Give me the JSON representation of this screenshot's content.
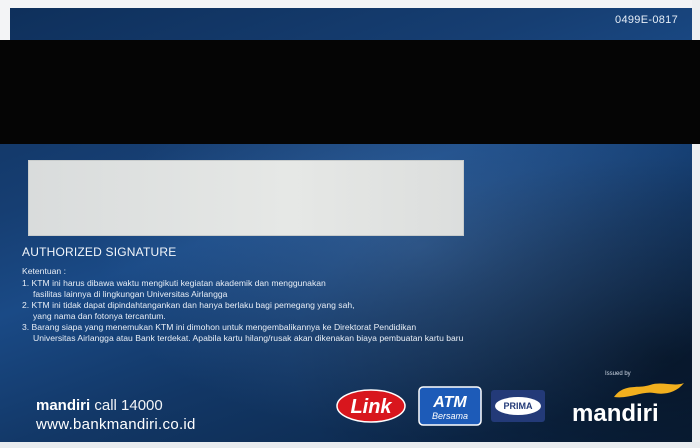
{
  "card": {
    "code": "0499E-0817",
    "signature_label": "AUTHORIZED SIGNATURE",
    "terms": {
      "heading": "Ketentuan :",
      "lines": [
        "1. KTM ini harus dibawa waktu mengikuti kegiatan akademik dan menggunakan",
        "fasilitas lainnya di lingkungan Universitas Airlangga",
        "2. KTM ini tidak dapat dipindahtangankan dan hanya berlaku bagi pemegang yang sah,",
        "yang nama dan fotonya tercantum.",
        "3. Barang siapa yang menemukan KTM ini dimohon untuk mengembalikannya ke Direktorat Pendidikan",
        "Universitas Airlangga atau Bank terdekat. Apabila kartu hilang/rusak akan dikenakan biaya pembuatan kartu baru"
      ]
    },
    "bank": {
      "name": "mandiri",
      "call": "call 14000",
      "url": "www.bankmandiri.co.id"
    },
    "logos": {
      "link": "Link",
      "atm_top": "ATM",
      "atm_bottom": "Bersama",
      "prima": "PRIMA",
      "issued_by": "Issued by",
      "mandiri": "mandiri"
    }
  },
  "colors": {
    "card_blue": "#163e72",
    "stripe": "#050505",
    "signature_panel": "#e1e3e2",
    "link_red": "#d8161d",
    "atm_blue": "#1d5bb8",
    "mandiri_gold": "#f2b01e"
  }
}
